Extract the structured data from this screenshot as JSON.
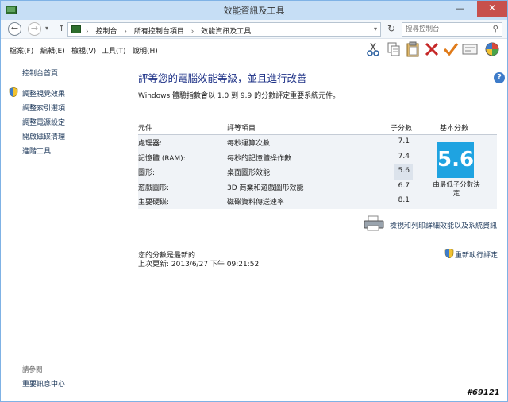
{
  "window": {
    "title": "效能資訊及工具",
    "minimize": "—",
    "maximize": "□",
    "close": "✕"
  },
  "address": {
    "back": "←",
    "forward": "→",
    "history_dropdown": "▾",
    "up": "↑",
    "crumbs": [
      "控制台",
      "所有控制台項目",
      "效能資訊及工具"
    ],
    "separator": "›",
    "dropdown": "▾",
    "refresh": "↻",
    "search_placeholder": "搜尋控制台",
    "search_icon": "⚲"
  },
  "menu": {
    "file": "檔案(F)",
    "edit": "編輯(E)",
    "view": "檢視(V)",
    "tools": "工具(T)",
    "help": "說明(H)"
  },
  "sidebar": {
    "home": "控制台首頁",
    "links": [
      "調整視覺效果",
      "調整索引選項",
      "調整電源設定",
      "開啟磁碟清理",
      "進階工具"
    ],
    "see_also_heading": "請參閱",
    "see_also_link": "重要訊息中心"
  },
  "main": {
    "title": "評等您的電腦效能等級，並且進行改善",
    "description": "Windows 體驗指數會以 1.0 到 9.9 的分數評定重要系統元件。",
    "help": "?",
    "table": {
      "headers": {
        "component": "元件",
        "rated_item": "評等項目",
        "subscore": "子分數",
        "base_score": "基本分數"
      },
      "rows": [
        {
          "component": "處理器:",
          "item": "每秒運算次數",
          "score": "7.1"
        },
        {
          "component": "記憶體 (RAM):",
          "item": "每秒的記憶體操作數",
          "score": "7.4"
        },
        {
          "component": "圖形:",
          "item": "桌面圖形效能",
          "score": "5.6"
        },
        {
          "component": "遊戲圖形:",
          "item": "3D 商業和遊戲圖形效能",
          "score": "6.7"
        },
        {
          "component": "主要硬碟:",
          "item": "磁碟資料傳送速率",
          "score": "8.1"
        }
      ],
      "base_score": "5.6",
      "base_caption_line1": "由最低子分數決",
      "base_caption_line2": "定"
    },
    "print_link": "檢視和列印詳細效能以及系統資訊",
    "status_line1": "您的分數是最新的",
    "status_line2": "上次更新: 2013/6/27 下午 09:21:52",
    "rerun_link": "重新執行評定"
  },
  "watermark": "#69121",
  "colors": {
    "titlebar": "#c6def5",
    "close_button": "#c7504c",
    "score_tile": "#1fa3e1",
    "link": "#1e395b",
    "title_text": "#1e3287"
  }
}
